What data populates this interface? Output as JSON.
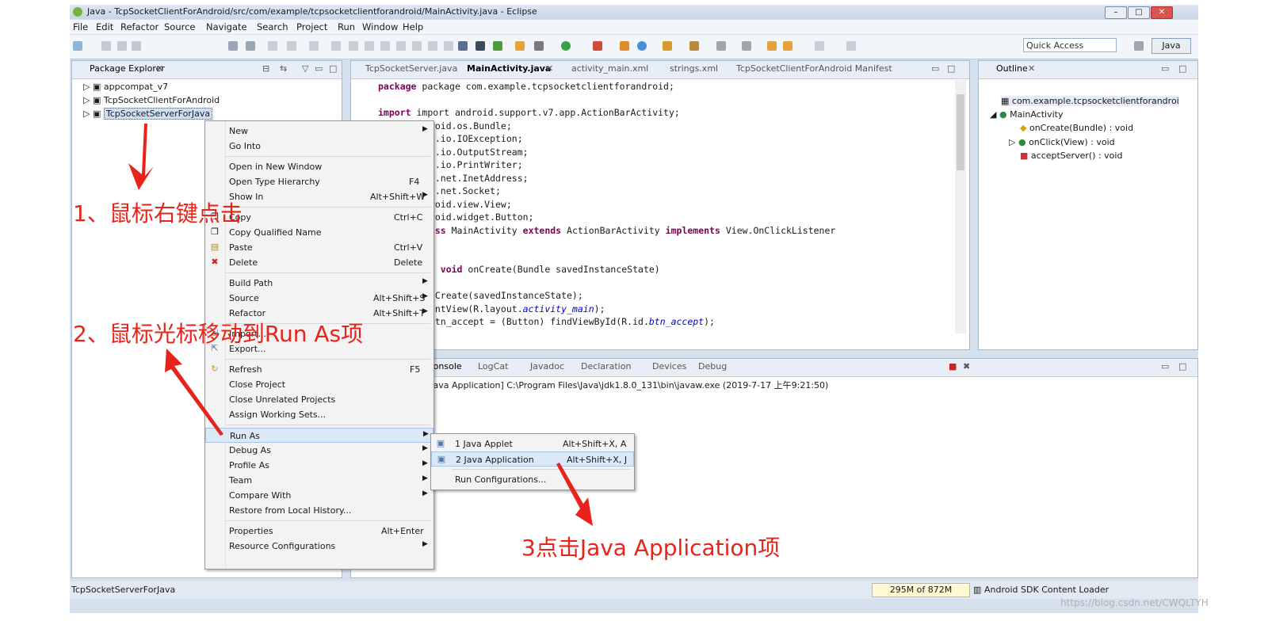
{
  "window": {
    "title": "Java - TcpSocketClientForAndroid/src/com/example/tcpsocketclientforandroid/MainActivity.java - Eclipse",
    "controls": [
      "–",
      "□",
      "✕"
    ]
  },
  "menubar": [
    "File",
    "Edit",
    "Refactor",
    "Source",
    "Navigate",
    "Search",
    "Project",
    "Run",
    "Window",
    "Help"
  ],
  "toolbar": {
    "quick_access_placeholder": "Quick Access",
    "perspective": "Java"
  },
  "package_explorer": {
    "title": "Package Explorer",
    "projects": [
      "appcompat_v7",
      "TcpSocketClientForAndroid",
      "TcpSocketServerForJava"
    ],
    "selected": "TcpSocketServerForJava"
  },
  "editor": {
    "tabs": [
      "TcpSocketServer.java",
      "MainActivity.java",
      "activity_main.xml",
      "strings.xml",
      "TcpSocketClientForAndroid Manifest"
    ],
    "active_tab": "MainActivity.java",
    "lines": [
      "package com.example.tcpsocketclientforandroid;",
      "",
      "import android.support.v7.app.ActionBarActivity;",
      "droid.os.Bundle;",
      "va.io.IOException;",
      "va.io.OutputStream;",
      "va.io.PrintWriter;",
      "va.net.InetAddress;",
      "va.net.Socket;",
      "droid.view.View;",
      "droid.widget.Button;",
      "lass MainActivity extends ActionBarActivity implements View.OnClickListener",
      "",
      "de",
      "ed void onCreate(Bundle savedInstanceState)",
      "",
      "onCreate(savedInstanceState);",
      "tentView(R.layout.activity_main);",
      " btn_accept = (Button) findViewById(R.id.btn_accept);"
    ]
  },
  "outline": {
    "title": "Outline",
    "items": [
      "com.example.tcpsocketclientforandroi",
      "MainActivity",
      "onCreate(Bundle) : void",
      "onClick(View) : void",
      "acceptServer() : void"
    ]
  },
  "console": {
    "tabs": [
      "Console",
      "LogCat",
      "Javadoc",
      "Declaration",
      "Devices",
      "Debug"
    ],
    "launch_line": "[Java Application] C:\\Program Files\\Java\\jdk1.8.0_131\\bin\\javaw.exe (2019-7-17 上午9:21:50)"
  },
  "context_menu": {
    "items": [
      {
        "label": "New",
        "shortcut": "",
        "submenu": true
      },
      {
        "label": "Go Into",
        "shortcut": "",
        "submenu": false
      },
      {
        "label": "Open in New Window",
        "shortcut": "",
        "submenu": false
      },
      {
        "label": "Open Type Hierarchy",
        "shortcut": "F4",
        "submenu": false
      },
      {
        "label": "Show In",
        "shortcut": "Alt+Shift+W",
        "submenu": true
      },
      {
        "label": "Copy",
        "shortcut": "Ctrl+C",
        "submenu": false
      },
      {
        "label": "Copy Qualified Name",
        "shortcut": "",
        "submenu": false
      },
      {
        "label": "Paste",
        "shortcut": "Ctrl+V",
        "submenu": false
      },
      {
        "label": "Delete",
        "shortcut": "Delete",
        "submenu": false
      },
      {
        "label": "Build Path",
        "shortcut": "",
        "submenu": true
      },
      {
        "label": "Source",
        "shortcut": "Alt+Shift+S",
        "submenu": true
      },
      {
        "label": "Refactor",
        "shortcut": "Alt+Shift+T",
        "submenu": true
      },
      {
        "label": "Import...",
        "shortcut": "",
        "submenu": false
      },
      {
        "label": "Export...",
        "shortcut": "",
        "submenu": false
      },
      {
        "label": "Refresh",
        "shortcut": "F5",
        "submenu": false
      },
      {
        "label": "Close Project",
        "shortcut": "",
        "submenu": false
      },
      {
        "label": "Close Unrelated Projects",
        "shortcut": "",
        "submenu": false
      },
      {
        "label": "Assign Working Sets...",
        "shortcut": "",
        "submenu": false
      },
      {
        "label": "Run As",
        "shortcut": "",
        "submenu": true
      },
      {
        "label": "Debug As",
        "shortcut": "",
        "submenu": true
      },
      {
        "label": "Profile As",
        "shortcut": "",
        "submenu": true
      },
      {
        "label": "Team",
        "shortcut": "",
        "submenu": true
      },
      {
        "label": "Compare With",
        "shortcut": "",
        "submenu": true
      },
      {
        "label": "Restore from Local History...",
        "shortcut": "",
        "submenu": false
      },
      {
        "label": "Properties",
        "shortcut": "Alt+Enter",
        "submenu": false
      },
      {
        "label": "Resource Configurations",
        "shortcut": "",
        "submenu": true
      }
    ]
  },
  "run_as_submenu": {
    "items": [
      {
        "label": "1 Java Applet",
        "shortcut": "Alt+Shift+X, A"
      },
      {
        "label": "2 Java Application",
        "shortcut": "Alt+Shift+X, J"
      },
      {
        "label": "Run Configurations...",
        "shortcut": ""
      }
    ]
  },
  "annotations": {
    "step1": "1、鼠标右键点击",
    "step2": "2、鼠标光标移动到Run As项",
    "step3": "3点击Java Application项",
    "color": "#e8231a"
  },
  "statusbar": {
    "selection": "TcpSocketServerForJava",
    "heap": "295M of 872M",
    "task": "Android SDK Content Loader",
    "watermark": "https://blog.csdn.net/CWQLTYH"
  }
}
